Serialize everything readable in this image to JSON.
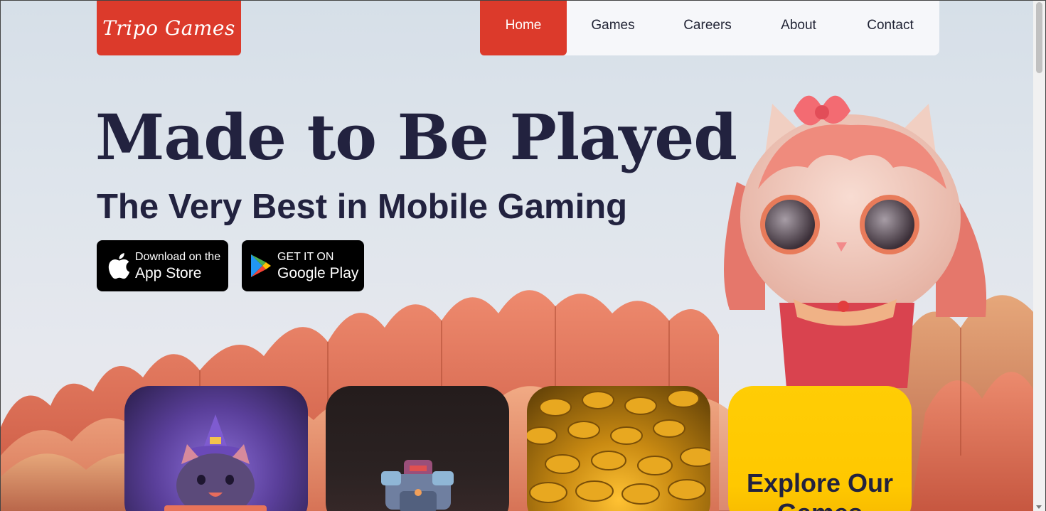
{
  "brand": {
    "logo_text": "Tripo Games",
    "accent_color": "#dc3a2b"
  },
  "nav": {
    "items": [
      {
        "label": "Home",
        "active": true
      },
      {
        "label": "Games",
        "active": false
      },
      {
        "label": "Careers",
        "active": false
      },
      {
        "label": "About",
        "active": false
      },
      {
        "label": "Contact",
        "active": false
      }
    ]
  },
  "hero": {
    "title": "Made to Be Played",
    "subtitle": "The Very Best in Mobile Gaming"
  },
  "badges": {
    "app_store": {
      "small": "Download on the",
      "big": "App Store",
      "icon": "apple-icon"
    },
    "google_play": {
      "small": "GET IT ON",
      "big": "Google Play",
      "icon": "google-play-icon"
    }
  },
  "cards": [
    {
      "image": "witch-cat-character"
    },
    {
      "image": "robot-character"
    },
    {
      "image": "gold-coins"
    },
    {
      "label": "Explore Our Games",
      "color": "#ffc800"
    }
  ]
}
